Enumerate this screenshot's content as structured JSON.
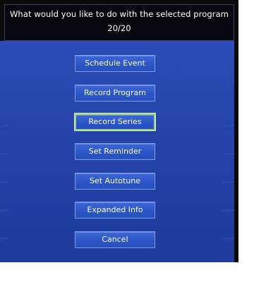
{
  "dialog": {
    "title_line1": "What would you like to do with the selected program",
    "title_line2": "20/20"
  },
  "menu": {
    "selected_index": 2,
    "items": [
      {
        "label": "Schedule Event"
      },
      {
        "label": "Record Program"
      },
      {
        "label": "Record Series"
      },
      {
        "label": "Set Reminder"
      },
      {
        "label": "Set Autotune"
      },
      {
        "label": "Expanded Info"
      },
      {
        "label": "Cancel"
      }
    ]
  },
  "colors": {
    "background_blue": "#2442a8",
    "button_blue": "#2c56c8",
    "selected_border": "#9ad48a"
  }
}
